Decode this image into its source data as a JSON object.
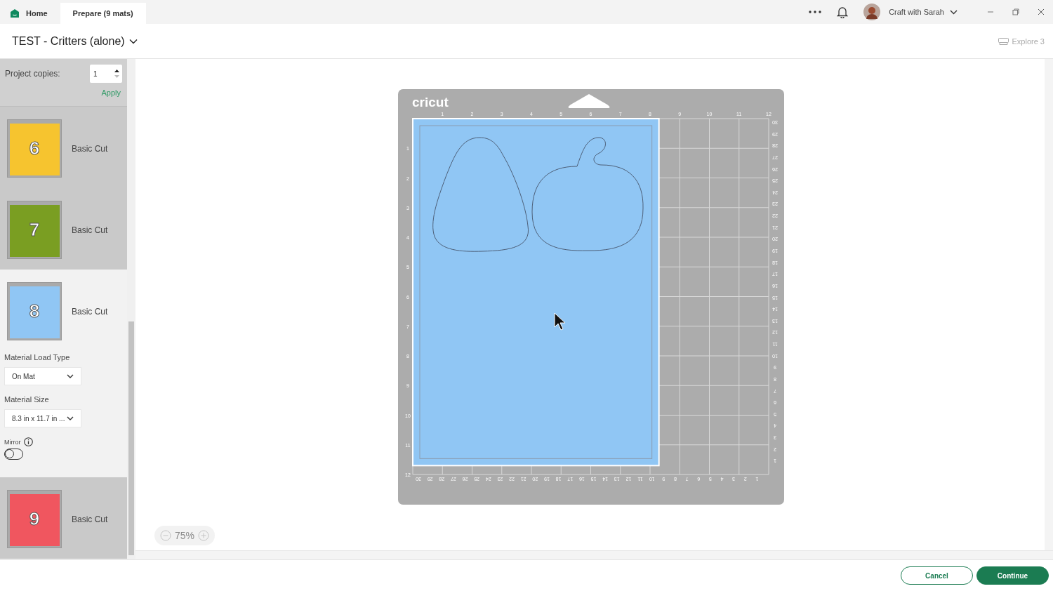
{
  "title_bar": {
    "tabs": [
      {
        "label": "Home",
        "selected": false,
        "kind": "home"
      },
      {
        "label": "Prepare (9 mats)",
        "selected": true,
        "kind": "page"
      }
    ],
    "user": "Craft with Sarah"
  },
  "project": {
    "title": "TEST - Critters (alone)",
    "machine": "Explore 3"
  },
  "copies": {
    "label": "Project copies:",
    "value": "1",
    "apply": "Apply"
  },
  "mats": [
    {
      "number": "6",
      "color": "#f6c42f",
      "label": "Basic Cut",
      "selected": false
    },
    {
      "number": "7",
      "color": "#7a9e22",
      "label": "Basic Cut",
      "selected": false
    },
    {
      "number": "8",
      "color": "#90c6f4",
      "label": "Basic Cut",
      "selected": true
    },
    {
      "number": "9",
      "color": "#f0565f",
      "label": "Basic Cut",
      "selected": false
    }
  ],
  "options": {
    "load_type_label": "Material Load Type",
    "load_type": "On Mat",
    "size_label": "Material Size",
    "size": "8.3 in x 11.7 in ...",
    "mirror_label": "Mirror",
    "mirror": false
  },
  "mat": {
    "brand": "cricut",
    "top_ruler": [
      "1",
      "2",
      "3",
      "4",
      "5",
      "6",
      "7",
      "8",
      "9",
      "10",
      "11",
      "12"
    ],
    "left_ruler": [
      "1",
      "2",
      "3",
      "4",
      "5",
      "6",
      "7",
      "8",
      "9",
      "10",
      "11",
      "12"
    ],
    "right_ruler": [
      "30",
      "29",
      "28",
      "27",
      "26",
      "25",
      "24",
      "23",
      "22",
      "21",
      "20",
      "19",
      "18",
      "17",
      "16",
      "15",
      "14",
      "13",
      "12",
      "11",
      "10",
      "9",
      "8",
      "7",
      "6",
      "5",
      "4",
      "3",
      "2",
      "1"
    ],
    "bottom_ruler": [
      "30",
      "29",
      "28",
      "27",
      "26",
      "25",
      "24",
      "23",
      "22",
      "21",
      "20",
      "19",
      "18",
      "17",
      "16",
      "15",
      "14",
      "13",
      "12",
      "11",
      "10",
      "9",
      "8",
      "7",
      "6",
      "5",
      "4",
      "3",
      "2",
      "1"
    ]
  },
  "zoom": "75%",
  "footer": {
    "buttons": [
      {
        "label": "Cancel",
        "kind": "secondary"
      },
      {
        "label": "Continue",
        "kind": "primary"
      }
    ]
  }
}
